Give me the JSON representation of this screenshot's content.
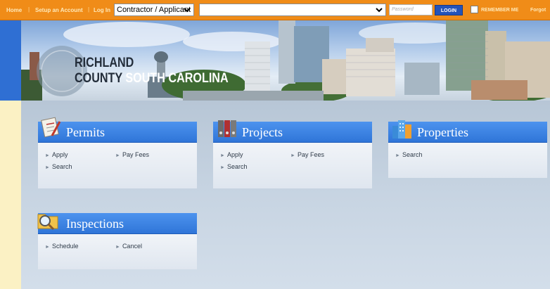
{
  "topbar": {
    "home": "Home",
    "separator": "|",
    "setup_account": "Setup an Account",
    "log_in": "Log In",
    "role_select_value": "Contractor / Applicant",
    "search_select_value": "",
    "password_placeholder": "Password",
    "login_button": "LOGIN",
    "remember_me": "REMEMBER ME",
    "forgot": "Forgot"
  },
  "banner": {
    "line1": "RICHLAND",
    "line2_a": "COUNTY",
    "line2_b": "SOUTH CAROLINA"
  },
  "cards": [
    {
      "title": "Permits",
      "links": [
        "Apply",
        "Pay Fees",
        "Search"
      ]
    },
    {
      "title": "Projects",
      "links": [
        "Apply",
        "Pay Fees",
        "Search"
      ]
    },
    {
      "title": "Properties",
      "links": [
        "Search"
      ]
    },
    {
      "title": "Inspections",
      "links": [
        "Schedule",
        "Cancel"
      ]
    }
  ],
  "colors": {
    "topbar": "#f08c18",
    "card_header": "#3a80e0",
    "login_button": "#2453b8"
  }
}
